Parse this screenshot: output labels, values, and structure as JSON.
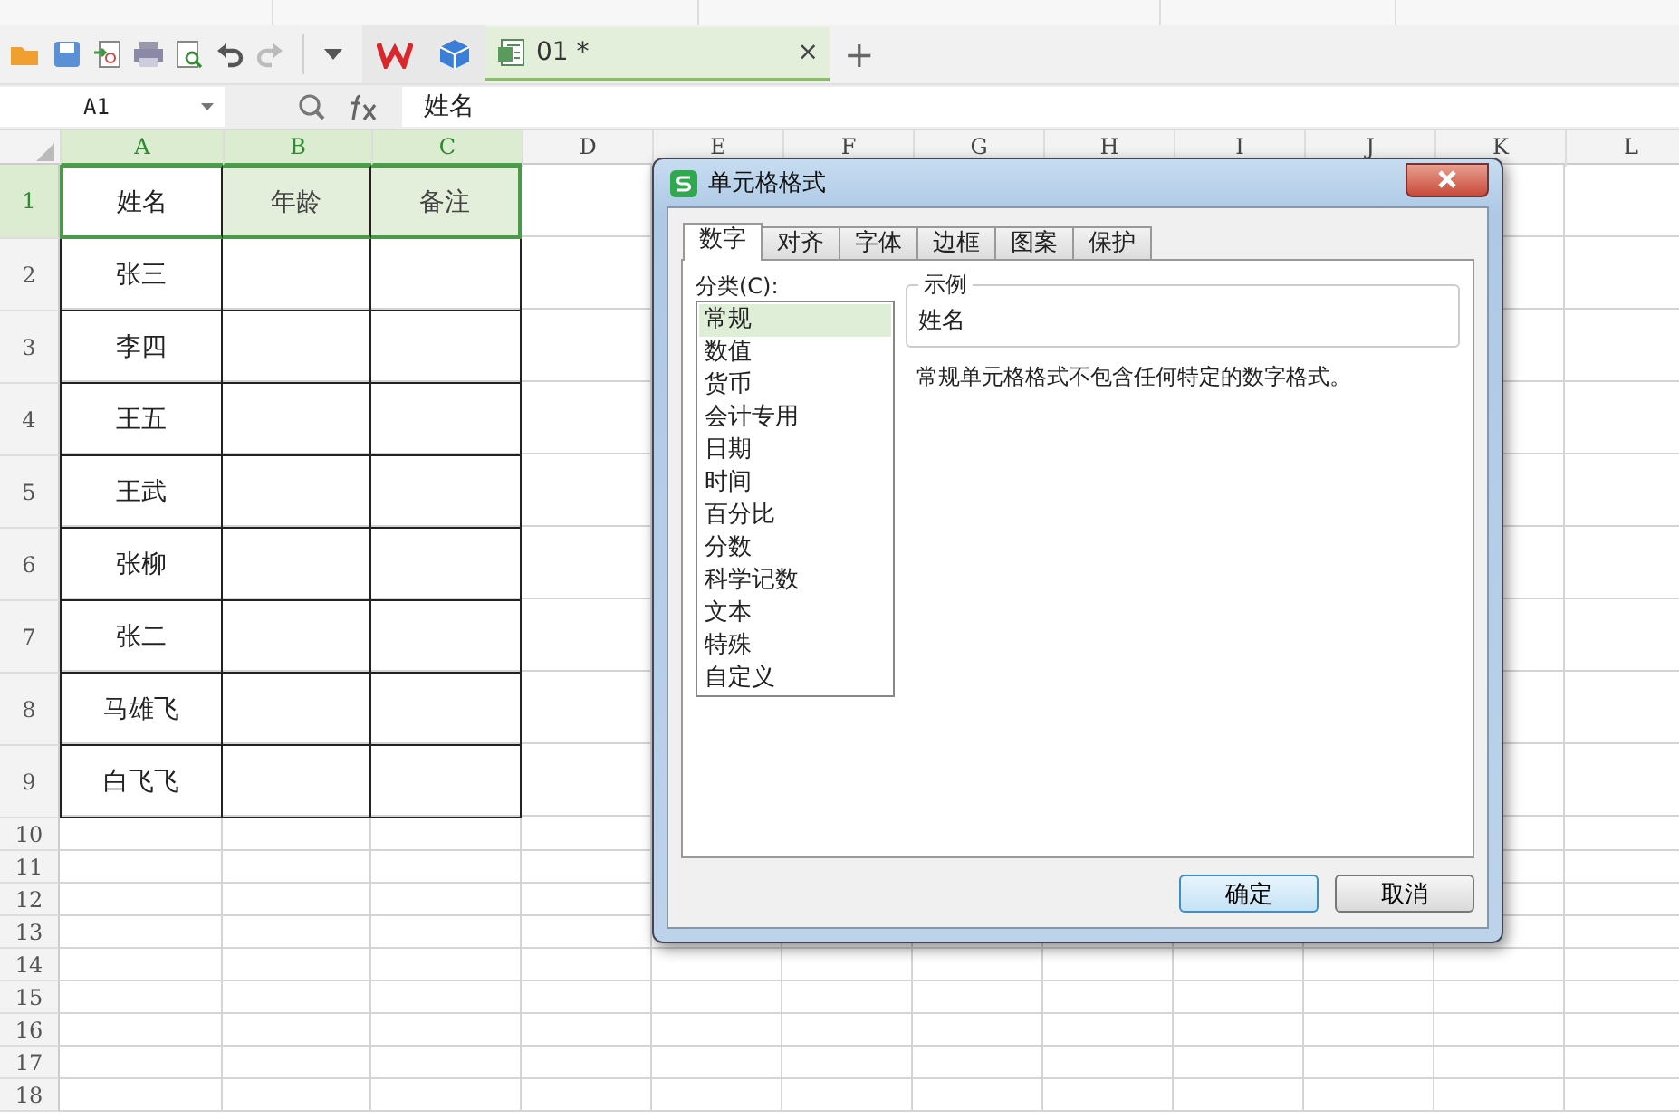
{
  "toolbar": {
    "document_tab": {
      "label": "01 *",
      "close": "×",
      "selected": true
    },
    "new_tab": "+"
  },
  "formula_bar": {
    "name_box": "A1",
    "value": "姓名"
  },
  "sheet": {
    "columns": [
      {
        "label": "A",
        "selected": true
      },
      {
        "label": "B",
        "selected": true
      },
      {
        "label": "C",
        "selected": true
      },
      {
        "label": "D",
        "selected": false
      },
      {
        "label": "E",
        "selected": false
      },
      {
        "label": "F",
        "selected": false
      },
      {
        "label": "G",
        "selected": false
      },
      {
        "label": "H",
        "selected": false
      },
      {
        "label": "I",
        "selected": false
      },
      {
        "label": "J",
        "selected": false
      },
      {
        "label": "K",
        "selected": false
      },
      {
        "label": "L",
        "selected": false
      }
    ],
    "rows": [
      {
        "header": "1",
        "selected": true,
        "cells": [
          "姓名",
          "年龄",
          "备注"
        ]
      },
      {
        "header": "2",
        "selected": false,
        "cells": [
          "张三",
          "",
          ""
        ]
      },
      {
        "header": "3",
        "selected": false,
        "cells": [
          "李四",
          "",
          ""
        ]
      },
      {
        "header": "4",
        "selected": false,
        "cells": [
          "王五",
          "",
          ""
        ]
      },
      {
        "header": "5",
        "selected": false,
        "cells": [
          "王武",
          "",
          ""
        ]
      },
      {
        "header": "6",
        "selected": false,
        "cells": [
          "张柳",
          "",
          ""
        ]
      },
      {
        "header": "7",
        "selected": false,
        "cells": [
          "张二",
          "",
          ""
        ]
      },
      {
        "header": "8",
        "selected": false,
        "cells": [
          "马雄飞",
          "",
          ""
        ]
      },
      {
        "header": "9",
        "selected": false,
        "cells": [
          "白飞飞",
          "",
          ""
        ]
      }
    ],
    "empty_rows": [
      "10",
      "11",
      "12",
      "13",
      "14",
      "15",
      "16",
      "17",
      "18"
    ]
  },
  "dialog": {
    "title": "单元格格式",
    "tabs": [
      {
        "label": "数字",
        "selected": true
      },
      {
        "label": "对齐",
        "selected": false
      },
      {
        "label": "字体",
        "selected": false
      },
      {
        "label": "边框",
        "selected": false
      },
      {
        "label": "图案",
        "selected": false
      },
      {
        "label": "保护",
        "selected": false
      }
    ],
    "category_label": "分类(C):",
    "categories": [
      {
        "label": "常规",
        "selected": true
      },
      {
        "label": "数值",
        "selected": false
      },
      {
        "label": "货币",
        "selected": false
      },
      {
        "label": "会计专用",
        "selected": false
      },
      {
        "label": "日期",
        "selected": false
      },
      {
        "label": "时间",
        "selected": false
      },
      {
        "label": "百分比",
        "selected": false
      },
      {
        "label": "分数",
        "selected": false
      },
      {
        "label": "科学记数",
        "selected": false
      },
      {
        "label": "文本",
        "selected": false
      },
      {
        "label": "特殊",
        "selected": false
      },
      {
        "label": "自定义",
        "selected": false
      }
    ],
    "sample_label": "示例",
    "sample_value": "姓名",
    "description": "常规单元格格式不包含任何特定的数字格式。",
    "buttons": [
      {
        "label": "确定",
        "default": true
      },
      {
        "label": "取消",
        "default": false
      }
    ]
  }
}
